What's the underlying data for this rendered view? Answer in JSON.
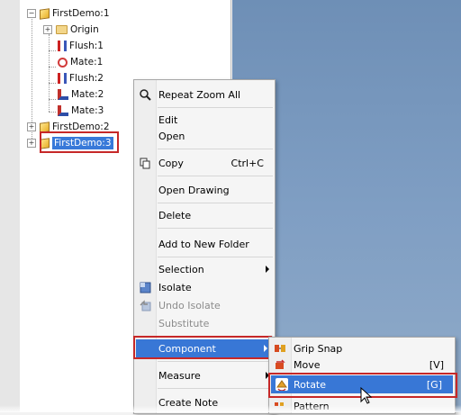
{
  "tree": {
    "nodes": [
      {
        "label": "FirstDemo:1",
        "icon": "part-icon",
        "expander": "−"
      },
      {
        "label": "Origin",
        "icon": "folder-icon",
        "expander": "+"
      },
      {
        "label": "Flush:1",
        "icon": "flush-icon"
      },
      {
        "label": "Mate:1",
        "icon": "mate-icon"
      },
      {
        "label": "Flush:2",
        "icon": "flush-icon"
      },
      {
        "label": "Mate:2",
        "icon": "mate-icon"
      },
      {
        "label": "Mate:3",
        "icon": "mate-icon"
      },
      {
        "label": "FirstDemo:2",
        "icon": "part-icon",
        "expander": "+"
      },
      {
        "label": "FirstDemo:3",
        "icon": "part-icon",
        "expander": "+",
        "selected": true
      }
    ]
  },
  "context_menu": {
    "items": [
      {
        "label": "Repeat Zoom All",
        "icon": "zoom-icon"
      },
      {
        "label": "Edit"
      },
      {
        "label": "Open"
      },
      {
        "label": "Copy",
        "shortcut": "Ctrl+C",
        "icon": "copy-icon"
      },
      {
        "label": "Open Drawing"
      },
      {
        "label": "Delete"
      },
      {
        "label": "Add to New Folder"
      },
      {
        "label": "Selection"
      },
      {
        "label": "Isolate",
        "icon": "isolate-icon"
      },
      {
        "label": "Undo Isolate",
        "icon": "undo-isolate-icon",
        "disabled": true
      },
      {
        "label": "Substitute",
        "disabled": true
      },
      {
        "label": "Component",
        "active": true
      },
      {
        "label": "Measure"
      },
      {
        "label": "Create Note"
      }
    ]
  },
  "submenu": {
    "items": [
      {
        "label": "Grip Snap",
        "icon": "grip-snap-icon"
      },
      {
        "label": "Move",
        "shortcut": "[V]",
        "icon": "move-icon"
      },
      {
        "label": "Rotate",
        "shortcut": "[G]",
        "icon": "rotate-icon",
        "active": true
      },
      {
        "label": "Pattern",
        "icon": "pattern-icon"
      }
    ]
  },
  "colors": {
    "highlight": "#3877d6",
    "callout_border": "#c62828",
    "viewport": "#7f9ec3"
  }
}
